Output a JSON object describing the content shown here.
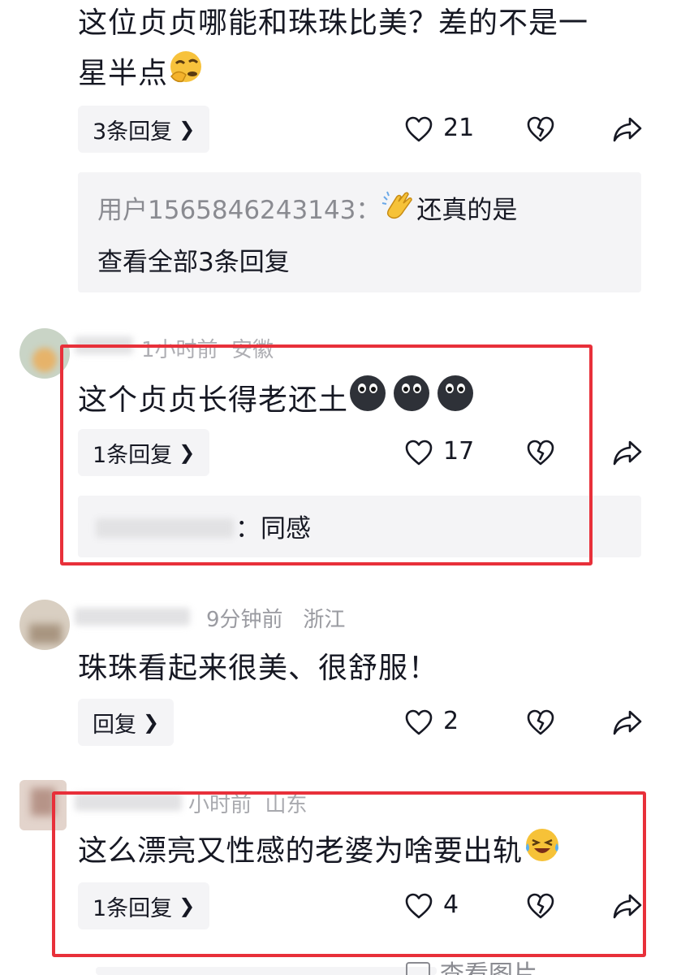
{
  "comments": [
    {
      "text_line1": "这位贞贞哪能和珠珠比美？差的不是一",
      "text_line2": "星半点",
      "reply_button": "3条回复",
      "likes": "21",
      "reply_preview": {
        "user": "用户1565846243143：",
        "text": "还真的是",
        "view_all": "查看全部3条回复"
      }
    },
    {
      "time": "1小时前",
      "location": "安徽",
      "text": "这个贞贞长得老还土",
      "reply_button": "1条回复",
      "likes": "17",
      "reply_preview": {
        "text": "：同感"
      }
    },
    {
      "time": "9分钟前",
      "location": "浙江",
      "text": "珠珠看起来很美、很舒服！",
      "reply_button": "回复",
      "likes": "2"
    },
    {
      "time": "小时前",
      "location": "山东",
      "text": "这么漂亮又性感的老婆为啥要出轨",
      "reply_button": "1条回复",
      "likes": "4"
    }
  ],
  "partial_bottom": {
    "text": "查看图片"
  },
  "colors": {
    "highlight": "#e8303a",
    "meta": "#9a9ba1",
    "pill_bg": "#f4f4f6"
  },
  "icons": [
    "heart-icon",
    "dislike-icon",
    "share-icon",
    "chevron-right-icon"
  ]
}
